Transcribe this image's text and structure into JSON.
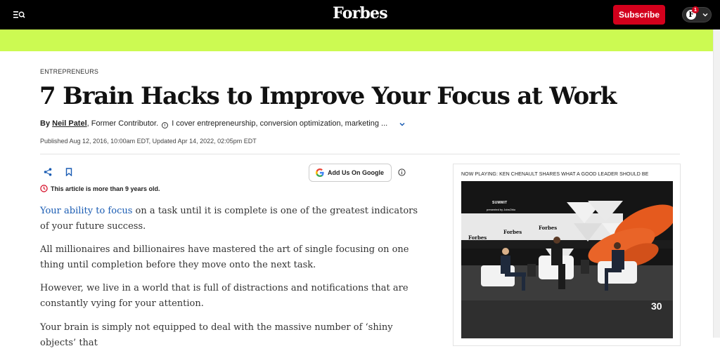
{
  "header": {
    "logo": "Forbes",
    "subscribe_label": "Subscribe",
    "profile_initial": "F",
    "notification_count": "1"
  },
  "article": {
    "category": "ENTREPRENEURS",
    "title": "7 Brain Hacks to Improve Your Focus at Work",
    "byline": {
      "by": "By",
      "author": "Neil Patel",
      "role": ", Former Contributor.",
      "bio": "I cover entrepreneurship, conversion optimization, marketing ..."
    },
    "published": "Published Aug 12, 2016, 10:00am EDT, Updated Apr 14, 2022, 02:05pm EDT",
    "google_button": "Add Us On Google",
    "age_notice": "This article is more than 9 years old.",
    "paragraphs": [
      {
        "link": "Your ability to focus",
        "text": " on a task until it is complete is one of the greatest indicators of your future success."
      },
      {
        "text": "All millionaires and billionaires have mastered the art of single focusing on one thing until completion before they move onto the next task."
      },
      {
        "text": "However, we live in a world that is full of distractions and notifications that are constantly vying for your attention."
      },
      {
        "text": "Your brain is simply not equipped to deal with the massive number of ‘shiny objects’ that"
      }
    ]
  },
  "video": {
    "now_playing": "NOW PLAYING: KEN CHENAULT SHARES WHAT A GOOD LEADER SHOULD BE",
    "stage_brand": "Forbes",
    "overlay_badge": "30",
    "backdrop_text": "SUMMIT",
    "presenter_text": "presented by JobsOhio"
  },
  "colors": {
    "brand_red": "#d3001c",
    "ad_band": "#ccfa52",
    "link_blue": "#1a5cb3"
  }
}
